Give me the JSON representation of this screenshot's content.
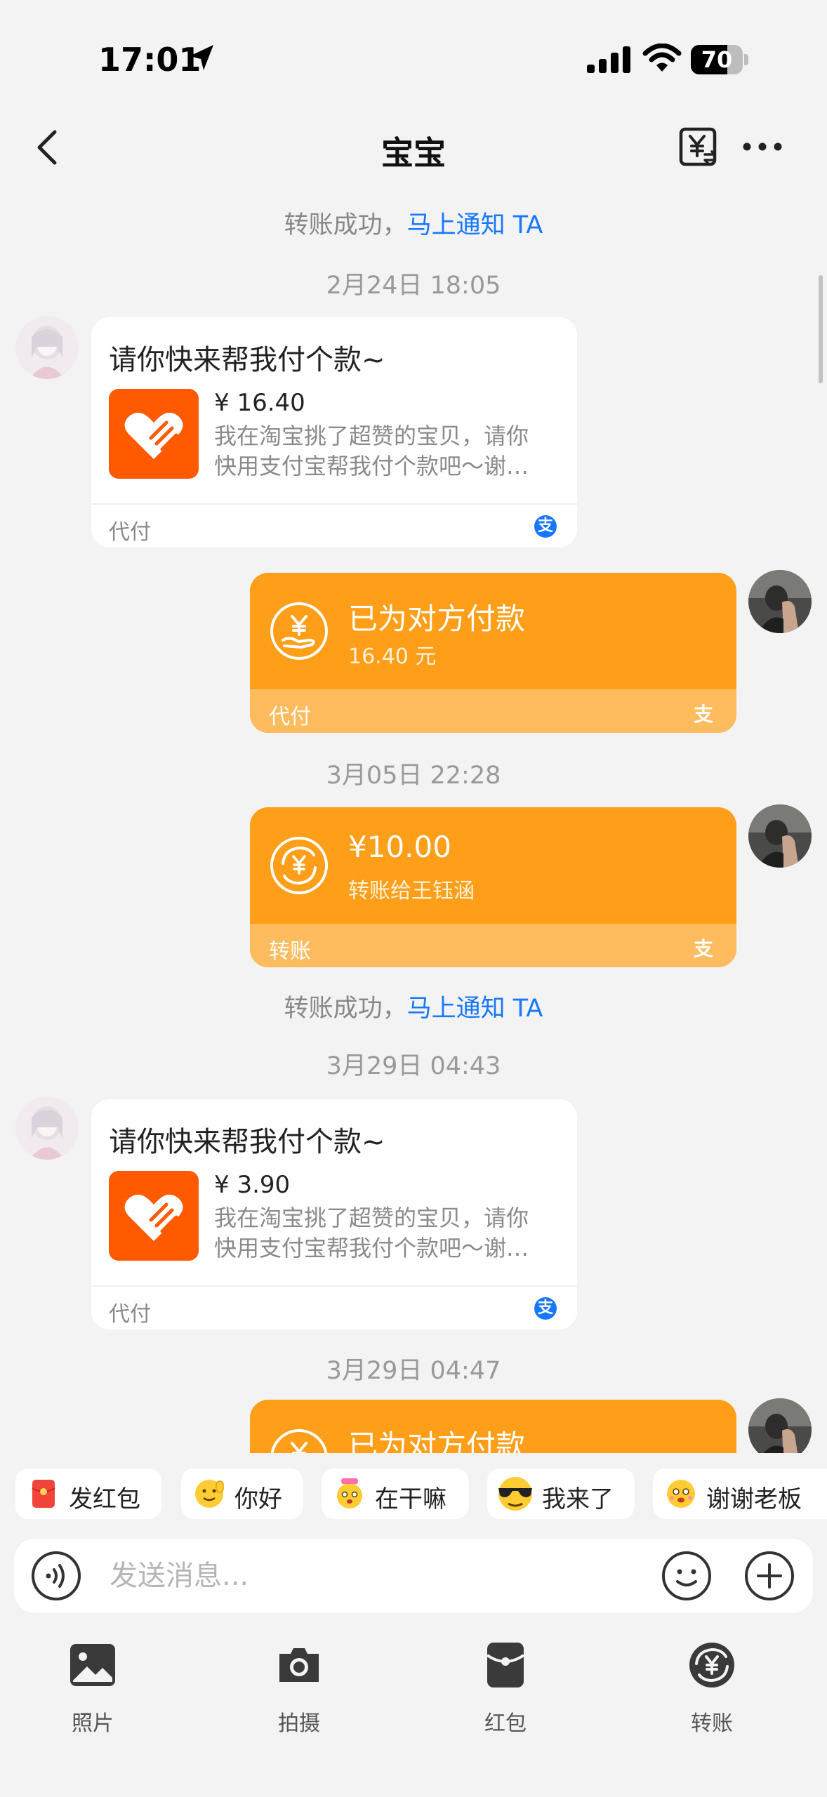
{
  "status_bar": {
    "time": "17:01",
    "battery": "70",
    "battery_level": 0.7
  },
  "header": {
    "title": "宝宝"
  },
  "messages": {
    "notice1": {
      "text": "转账成功，",
      "link": "马上通知 TA"
    },
    "ts1": "2月24日 18:05",
    "request1": {
      "title": "请你快来帮我付个款~",
      "amount": "¥ 16.40",
      "desc_line1": "我在淘宝挑了超赞的宝贝，请你",
      "desc_line2": "快用支付宝帮我付个款吧～谢…",
      "footer": "代付"
    },
    "payment1": {
      "title": "已为对方付款",
      "sub": "16.40 元",
      "footer": "代付"
    },
    "ts2": "3月05日 22:28",
    "transfer1": {
      "title": "¥10.00",
      "sub": "转账给王钰涵",
      "footer": "转账"
    },
    "notice2": {
      "text": "转账成功，",
      "link": "马上通知 TA"
    },
    "ts3": "3月29日 04:43",
    "request2": {
      "title": "请你快来帮我付个款~",
      "amount": "¥ 3.90",
      "desc_line1": "我在淘宝挑了超赞的宝贝，请你",
      "desc_line2": "快用支付宝帮我付个款吧～谢…",
      "footer": "代付"
    },
    "ts4": "3月29日 04:47",
    "payment2": {
      "title": "已为对方付款"
    }
  },
  "quick_replies": [
    {
      "label": "发红包",
      "icon": "red-envelope-icon"
    },
    {
      "label": "你好",
      "icon": "emoji-hello-icon"
    },
    {
      "label": "在干嘛",
      "icon": "emoji-busy-icon"
    },
    {
      "label": "我来了",
      "icon": "emoji-sunglasses-icon"
    },
    {
      "label": "谢谢老板",
      "icon": "emoji-thanks-icon"
    }
  ],
  "input": {
    "placeholder": "发送消息..."
  },
  "toolbar": [
    {
      "label": "照片",
      "icon": "photo-icon"
    },
    {
      "label": "拍摄",
      "icon": "camera-icon"
    },
    {
      "label": "红包",
      "icon": "red-packet-icon"
    },
    {
      "label": "转账",
      "icon": "transfer-icon"
    }
  ],
  "colors": {
    "accent_orange": "#ff9f19",
    "link_blue": "#1677ff",
    "taobao_orange": "#ff5a00",
    "background": "#f3f3f3"
  }
}
